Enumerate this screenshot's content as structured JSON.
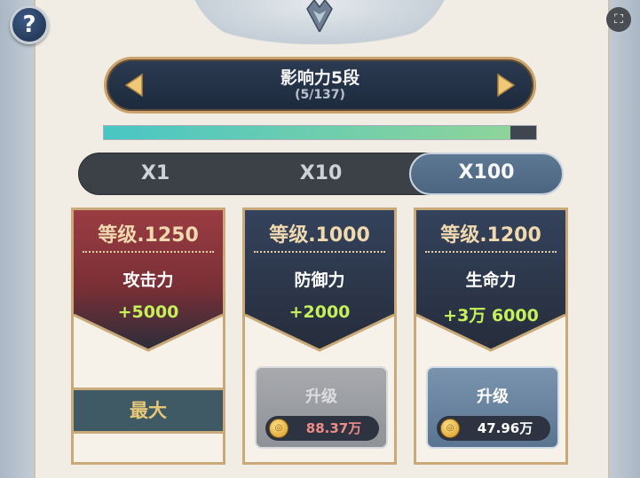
{
  "help": {
    "label": "?"
  },
  "level": {
    "title": "影响力5段",
    "progress_text": "(5/137)",
    "progress_fraction": 0.94
  },
  "multipliers": {
    "options": [
      {
        "label": "X1",
        "active": false
      },
      {
        "label": "X10",
        "active": false
      },
      {
        "label": "X100",
        "active": true
      }
    ]
  },
  "cards": [
    {
      "level": "等级.1250",
      "name": "攻击力",
      "value": "+5000",
      "status": "最大",
      "color": "#8a3a3f"
    },
    {
      "level": "等级.1000",
      "name": "防御力",
      "value": "+2000",
      "upgrade_label": "升级",
      "cost": "88.37万",
      "enabled": false,
      "color": "#2d3a52"
    },
    {
      "level": "等级.1200",
      "name": "生命力",
      "value": "+3万 6000",
      "upgrade_label": "升级",
      "cost": "47.96万",
      "enabled": true,
      "color": "#2d3a52"
    }
  ],
  "colors": {
    "accent_gold": "#c9a977",
    "value_green": "#c6f05a",
    "progress_start": "#49c6c4",
    "progress_end": "#8ed49a"
  }
}
